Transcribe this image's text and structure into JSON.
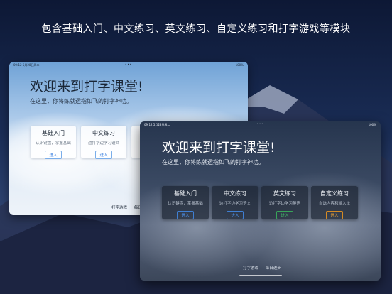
{
  "banner": "包含基础入门、中文练习、英文练习、自定义练习和打字游戏等模块",
  "light_screen": {
    "status_time": "09:12  5月28日周二",
    "status_battery": "100%",
    "welcome": "欢迎来到打字课堂!",
    "subtitle": "在这里，你将练就运指如飞的打字神功。",
    "cards": [
      {
        "title": "基础入门",
        "desc": "认识键盘，掌握基础",
        "button": "进入"
      },
      {
        "title": "中文练习",
        "desc": "边打字边学习语文",
        "button": "进入"
      },
      {
        "title": "",
        "desc": "",
        "button": ""
      }
    ],
    "footer": [
      "打字游戏",
      "每日进步"
    ]
  },
  "dark_screen": {
    "status_time": "09:12  5月28日周二",
    "status_battery": "100%",
    "welcome": "欢迎来到打字课堂!",
    "subtitle": "在这里，你将练就运指如飞的打字神功。",
    "cards": [
      {
        "title": "基础入门",
        "desc": "认识键盘，掌握基础",
        "button": "进入"
      },
      {
        "title": "中文练习",
        "desc": "边打字边学习语文",
        "button": "进入"
      },
      {
        "title": "英文练习",
        "desc": "边打字边学习英语",
        "button": "进入"
      },
      {
        "title": "自定义练习",
        "desc": "自选内容和输入法",
        "button": "进入"
      }
    ],
    "footer": [
      "打字游戏",
      "每日进步"
    ]
  },
  "colors": {
    "accent_blue": "#4e9bff",
    "accent_green": "#42c86a",
    "accent_orange": "#f3a431"
  }
}
